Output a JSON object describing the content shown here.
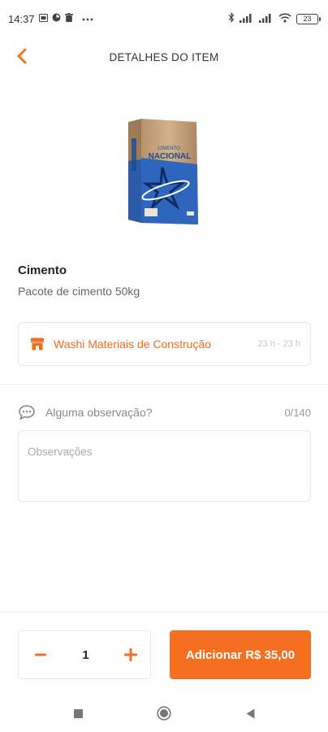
{
  "status_bar": {
    "time": "14:37",
    "battery": "23"
  },
  "header": {
    "title": "DETALHES DO ITEM"
  },
  "product": {
    "name": "Cimento",
    "description": "Pacote de cimento 50kg",
    "bag_brand": "NACIONAL",
    "bag_line": "CIMENTO"
  },
  "store": {
    "name": "Washi Materiais de Construção",
    "hours": "23 h - 23 h"
  },
  "observation": {
    "label": "Alguma observação?",
    "counter": "0/140",
    "placeholder": "Observações",
    "value": ""
  },
  "cart": {
    "quantity": "1",
    "add_label": "Adicionar R$ 35,00"
  },
  "colors": {
    "accent": "#f46f1f",
    "store_text": "#f06c20"
  }
}
